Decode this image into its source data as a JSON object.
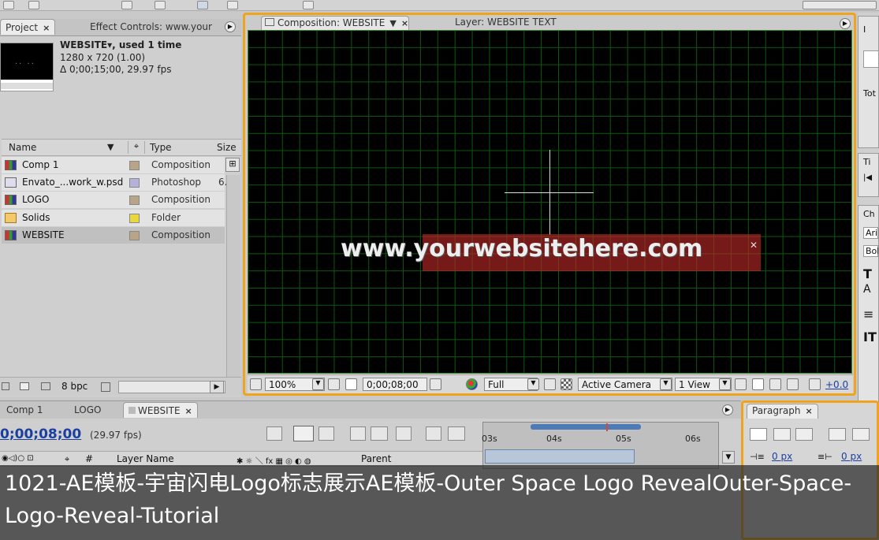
{
  "project_panel": {
    "tab_project": "Project",
    "tab_effect": "Effect Controls: www.your",
    "comp_name": "WEBSITE▾, used 1 time",
    "comp_size": "1280 x 720 (1.00)",
    "comp_duration": "Δ 0;00;15;00, 29.97 fps",
    "columns": {
      "name": "Name",
      "type": "Type",
      "size": "Size"
    },
    "items": [
      {
        "name": "Comp 1",
        "type": "Composition",
        "size": "",
        "label_color": "#b8a488"
      },
      {
        "name": "Envato_...work_w.psd",
        "type": "Photoshop",
        "size": "6.",
        "label_color": "#b6b1d9"
      },
      {
        "name": "LOGO",
        "type": "Composition",
        "size": "",
        "label_color": "#b8a488"
      },
      {
        "name": "Solids",
        "type": "Folder",
        "size": "",
        "label_color": "#e8d83b"
      },
      {
        "name": "WEBSITE",
        "type": "Composition",
        "size": "",
        "label_color": "#b8a488"
      }
    ],
    "bpc": "8 bpc"
  },
  "composition_panel": {
    "tab_comp": "Composition: WEBSITE",
    "tab_layer": "Layer: WEBSITE TEXT",
    "viewer_text": "www.yourwebsitehere.com",
    "zoom": "100%",
    "timecode": "0;00;08;00",
    "resolution": "Full",
    "camera": "Active Camera",
    "views": "1 View",
    "exposure": "+0.0"
  },
  "timeline_panel": {
    "tabs": [
      "Comp 1",
      "LOGO",
      "WEBSITE"
    ],
    "timecode": "0;00;08;00",
    "fps": "(29.97 fps)",
    "layer_name_header": "Layer Name",
    "parent_header": "Parent",
    "hash_header": "#",
    "ruler_marks": [
      "03s",
      "04s",
      "05s",
      "06s"
    ]
  },
  "paragraph_panel": {
    "tab": "Paragraph",
    "indent_left": "0 px",
    "indent_right": "0 px"
  },
  "right_panels": {
    "info_label": "I",
    "total_label": "Tot",
    "time_label": "Ti",
    "char_label": "Ch",
    "font": "Ari",
    "style": "Bol"
  },
  "caption": "1021-AE模板-宇宙闪电Logo标志展示AE模板-Outer Space Logo RevealOuter-Space-Logo-Reveal-Tutorial"
}
